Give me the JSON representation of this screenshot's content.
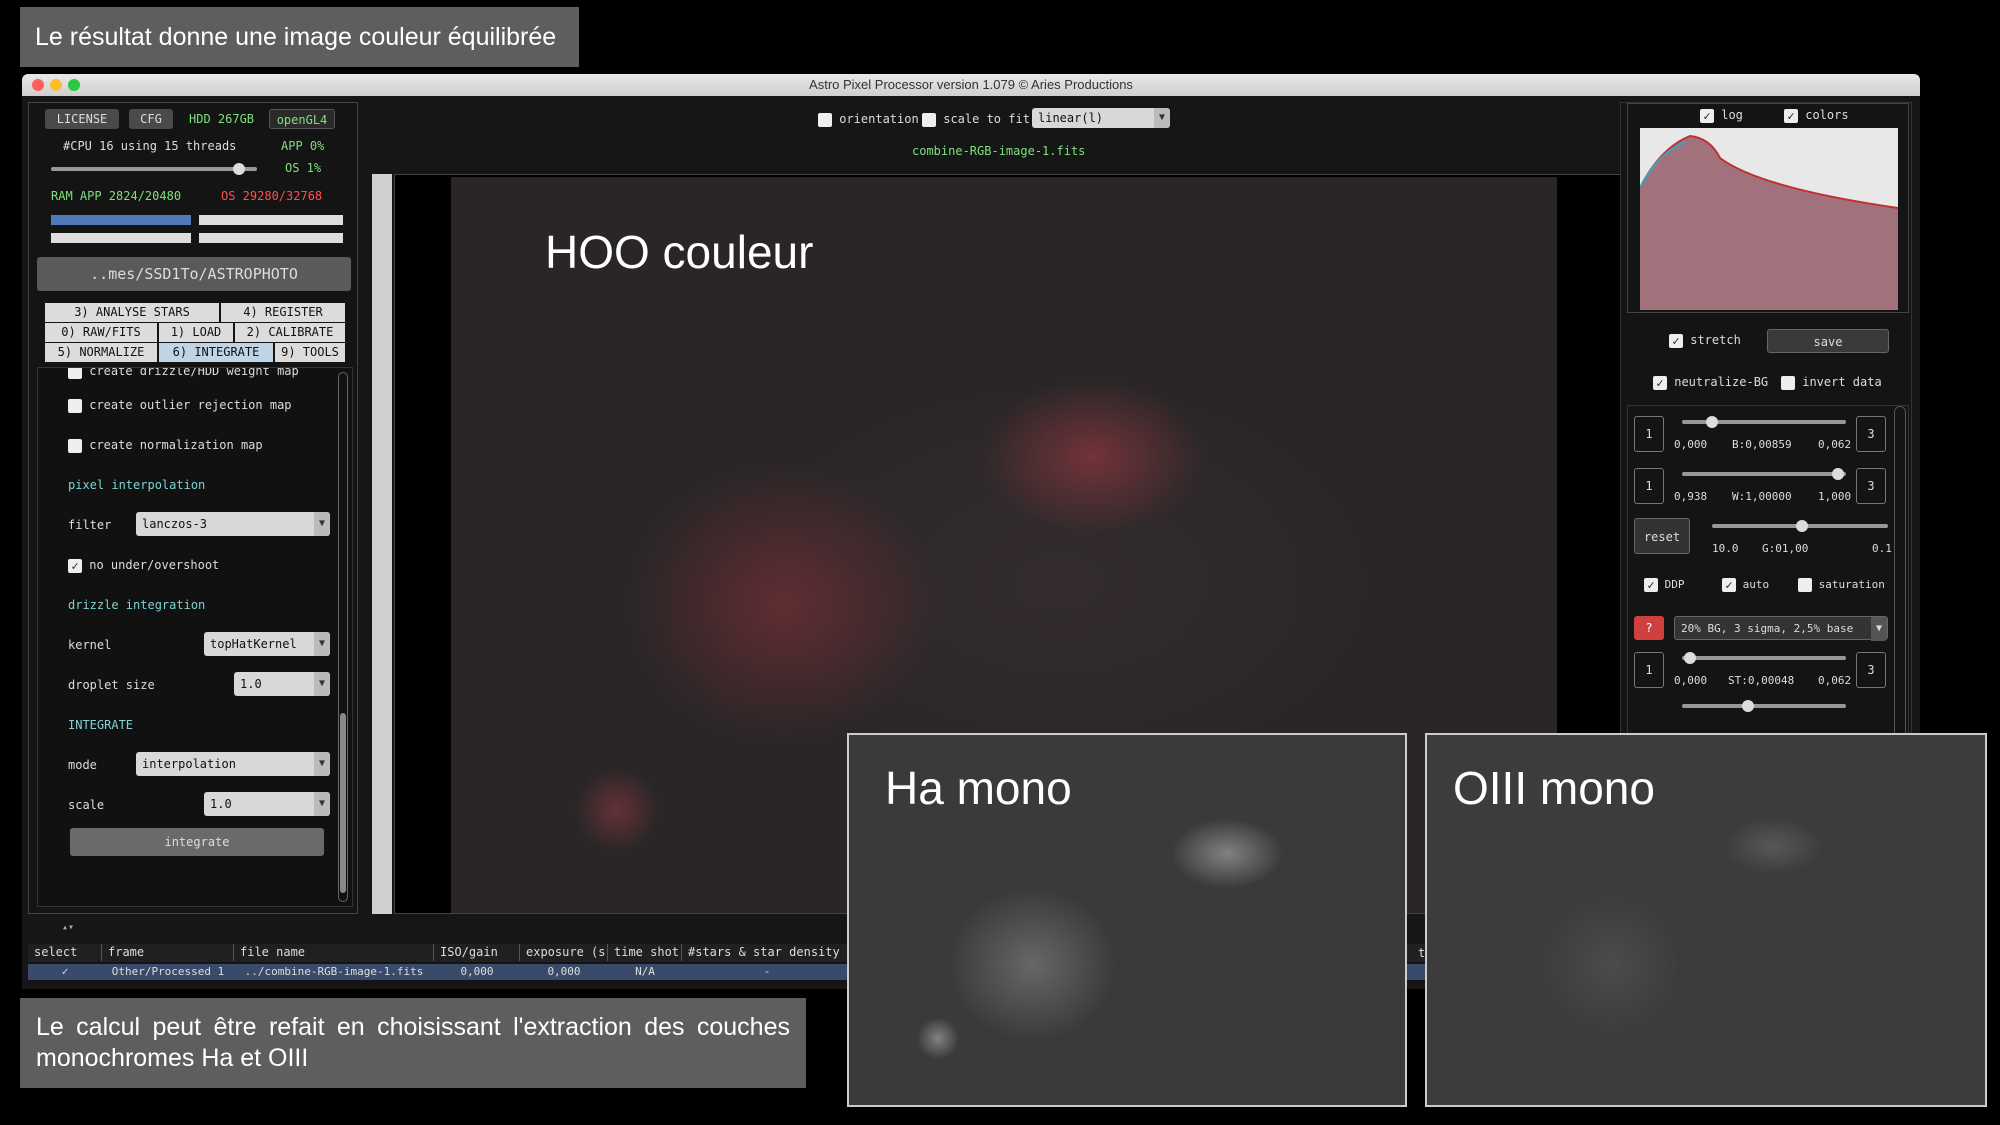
{
  "captions": {
    "top": "Le résultat donne une image couleur équilibrée",
    "bottom": "Le calcul peut être refait en choisissant l'extraction des couches monochromes Ha et OIII"
  },
  "window": {
    "title": "Astro Pixel Processor version 1.079 © Aries Productions"
  },
  "left_panel": {
    "license": "LICENSE",
    "cfg": "CFG",
    "hdd": "HDD 267GB",
    "opengl": "openGL4",
    "cpu": "#CPU 16  using 15 threads",
    "app_pct": "APP 0%",
    "os_pct": "OS 1%",
    "ram_app": "RAM  APP 2824/20480",
    "ram_os": "OS 29280/32768",
    "path": "..mes/SSD1To/ASTROPHOTO",
    "tabs_row1": [
      "3) ANALYSE STARS",
      "4) REGISTER"
    ],
    "tabs_row2": [
      "0) RAW/FITS",
      "1) LOAD",
      "2) CALIBRATE"
    ],
    "tabs_row3": [
      "5) NORMALIZE",
      "6) INTEGRATE",
      "9) TOOLS"
    ],
    "opt_cut": "create drizzle/HDD weight map",
    "opt_outlier": "create outlier rejection map",
    "opt_norm": "create normalization map",
    "pixel_interp": "pixel interpolation",
    "filter_label": "filter",
    "filter_value": "lanczos-3",
    "no_overshoot": "no under/overshoot",
    "drizzle": "drizzle integration",
    "kernel_label": "kernel",
    "kernel_value": "topHatKernel",
    "droplet_label": "droplet size",
    "droplet_value": "1.0",
    "integrate_header": "INTEGRATE",
    "mode_label": "mode",
    "mode_value": "interpolation",
    "scale_label": "scale",
    "scale_value": "1.0",
    "integrate_btn": "integrate"
  },
  "top_bar": {
    "orientation": "orientation",
    "scale_to_fit": "scale to fit",
    "stretch_select": "linear(l)",
    "filename": "combine-RGB-image-1.fits"
  },
  "images": {
    "main_label": "HOO couleur",
    "ha_label": "Ha mono",
    "oiii_label": "OIII mono"
  },
  "right_panel": {
    "log": "log",
    "colors": "colors",
    "stretch": "stretch",
    "save": "save",
    "neutralize": "neutralize-BG",
    "invert": "invert data",
    "b_min": "0,000",
    "b_val": "B:0,00859",
    "b_max": "0,062",
    "w_min": "0,938",
    "w_val": "W:1,00000",
    "w_max": "1,000",
    "reset": "reset",
    "g_min": "10.0",
    "g_val": "G:01,00",
    "g_max": "0.1",
    "ddp": "DDP",
    "auto": "auto",
    "saturation": "saturation",
    "question": "?",
    "preset": "20% BG, 3 sigma, 2,5% base",
    "st_min": "0,000",
    "st_val": "ST:0,00048",
    "st_max": "0,062",
    "one": "1",
    "three": "3"
  },
  "table": {
    "headers": [
      "select",
      "frame",
      "file name",
      "ISO/gain",
      "exposure (s)",
      "time shot",
      "#stars & star density"
    ],
    "row": [
      "✓",
      "Other/Processed 1",
      "../combine-RGB-image-1.fits",
      "0,000",
      "0,000",
      "N/A",
      "-"
    ],
    "tail": "ty"
  }
}
